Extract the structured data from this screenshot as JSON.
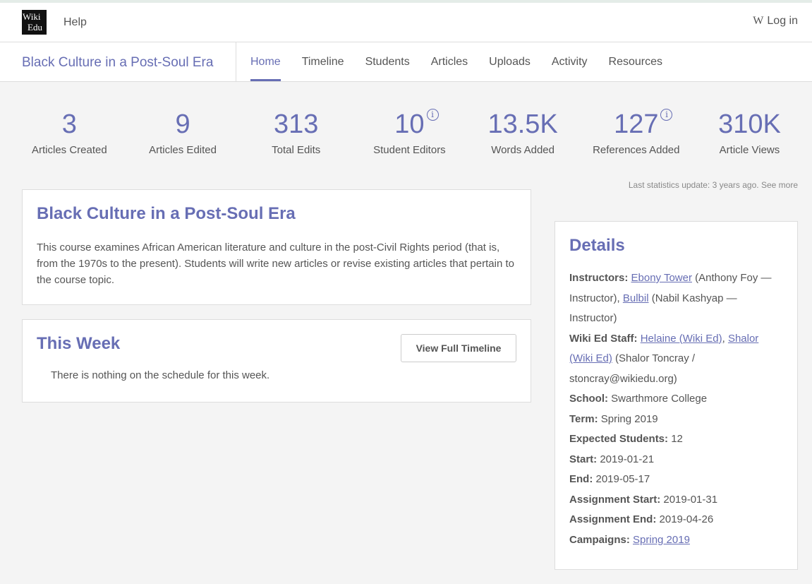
{
  "header": {
    "logo_line1": "Wiki",
    "logo_line2": "Edu",
    "help_label": "Help",
    "login_icon": "W",
    "login_label": "Log in"
  },
  "course": {
    "title": "Black Culture in a Post-Soul Era"
  },
  "tabs": [
    {
      "label": "Home",
      "active": true
    },
    {
      "label": "Timeline"
    },
    {
      "label": "Students"
    },
    {
      "label": "Articles"
    },
    {
      "label": "Uploads"
    },
    {
      "label": "Activity"
    },
    {
      "label": "Resources"
    }
  ],
  "stats": [
    {
      "value": "3",
      "label": "Articles Created"
    },
    {
      "value": "9",
      "label": "Articles Edited"
    },
    {
      "value": "313",
      "label": "Total Edits"
    },
    {
      "value": "10",
      "label": "Student Editors",
      "info": "i"
    },
    {
      "value": "13.5K",
      "label": "Words Added"
    },
    {
      "value": "127",
      "label": "References Added",
      "info": "i"
    },
    {
      "value": "310K",
      "label": "Article Views"
    }
  ],
  "stats_update": {
    "text": "Last statistics update: 3 years ago.",
    "link": "See more"
  },
  "description": {
    "title": "Black Culture in a Post-Soul Era",
    "body": "This course examines African American literature and culture in the post-Civil Rights period (that is, from the 1970s to the present). Students will write new articles or revise existing articles that pertain to the course topic."
  },
  "this_week": {
    "title": "This Week",
    "button_label": "View Full Timeline",
    "empty_text": "There is nothing on the schedule for this week."
  },
  "details": {
    "title": "Details",
    "instructors_label": "Instructors:",
    "instructor1_link": "Ebony Tower",
    "instructor1_text": " (Anthony Foy — Instructor), ",
    "instructor2_link": "Bulbil",
    "instructor2_text": " (Nabil Kashyap — Instructor)",
    "staff_label": "Wiki Ed Staff:",
    "staff1_link": "Helaine (Wiki Ed)",
    "staff_sep": ", ",
    "staff2_link": "Shalor (Wiki Ed)",
    "staff2_text": " (Shalor Toncray / stoncray@wikiedu.org)",
    "school_label": "School:",
    "school_value": " Swarthmore College",
    "term_label": "Term:",
    "term_value": " Spring 2019",
    "expected_label": "Expected Students:",
    "expected_value": " 12",
    "start_label": "Start:",
    "start_value": " 2019-01-21",
    "end_label": "End:",
    "end_value": " 2019-05-17",
    "assign_start_label": "Assignment Start:",
    "assign_start_value": " 2019-01-31",
    "assign_end_label": "Assignment End:",
    "assign_end_value": " 2019-04-26",
    "campaigns_label": "Campaigns:",
    "campaign_link": "Spring 2019"
  },
  "colors": {
    "accent": "#676eb4",
    "background": "#f4f4f4"
  }
}
